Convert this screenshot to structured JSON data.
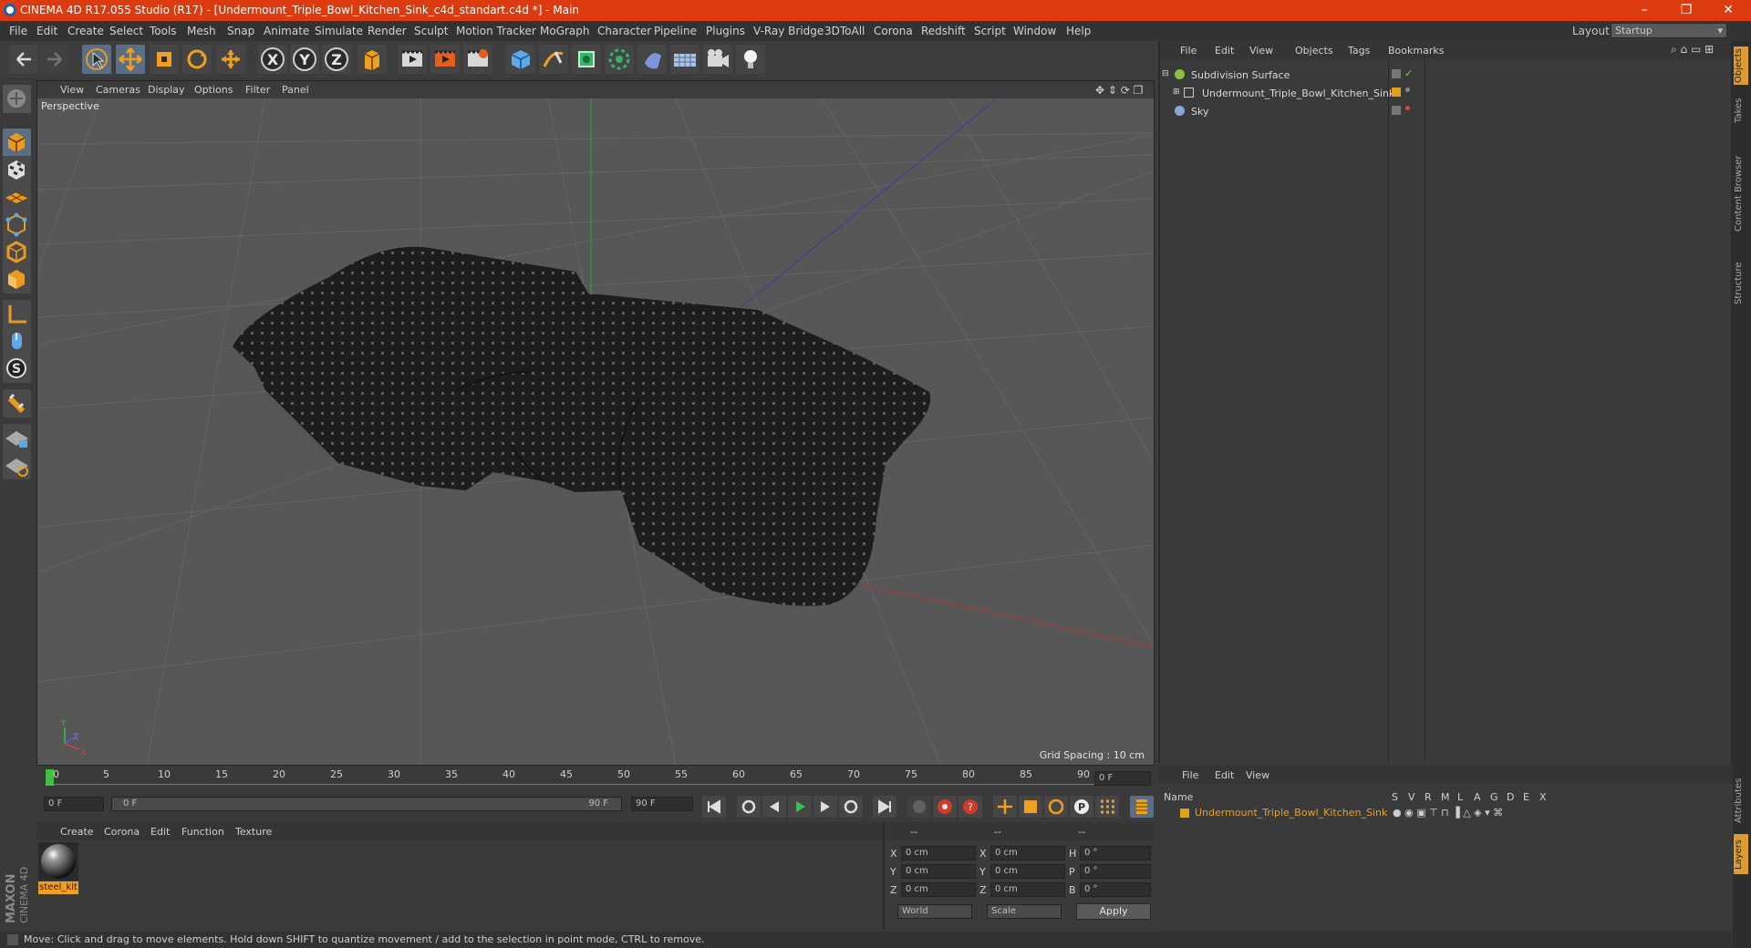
{
  "window": {
    "title": "CINEMA 4D R17.055 Studio (R17) - [Undermount_Triple_Bowl_Kitchen_Sink_c4d_standart.c4d *] - Main",
    "minimize": "–",
    "restore": "❐",
    "close": "✕"
  },
  "menubar": {
    "items": [
      "File",
      "Edit",
      "Create",
      "Select",
      "Tools",
      "Mesh",
      "Snap",
      "Animate",
      "Simulate",
      "Render",
      "Sculpt",
      "Motion Tracker",
      "MoGraph",
      "Character",
      "Pipeline",
      "Plugins",
      "V-Ray Bridge",
      "3DToAll",
      "Corona",
      "Redshift",
      "Script",
      "Window",
      "Help"
    ],
    "layout_label": "Layout:",
    "layout_value": "Startup"
  },
  "toolbar": {
    "axis_x": "X",
    "axis_y": "Y",
    "axis_z": "Z",
    "icons": [
      "undo-icon",
      "redo-icon",
      "select-arrow-icon",
      "move-icon",
      "scale-icon",
      "rotate-icon",
      "move-last-icon",
      "axis-x-icon",
      "axis-y-icon",
      "axis-z-icon",
      "coordinate-system-icon",
      "render-view-icon",
      "render-picture-viewer-icon",
      "render-settings-icon",
      "cube-icon",
      "pen-icon",
      "subdivision-icon",
      "array-icon",
      "deformer-icon",
      "floor-icon",
      "camera-icon",
      "light-icon"
    ]
  },
  "viewport": {
    "menu": [
      "View",
      "Cameras",
      "Display",
      "Options",
      "Filter",
      "Panel"
    ],
    "label": "Perspective",
    "grid_spacing": "Grid Spacing : 10 cm",
    "axis_y": "Y",
    "axis_z": "Z",
    "axis_x": "X"
  },
  "object_manager": {
    "menu": [
      "File",
      "Edit",
      "View",
      "Objects",
      "Tags",
      "Bookmarks"
    ],
    "objects": [
      {
        "name": "Subdivision Surface",
        "color": "#8ac23f"
      },
      {
        "name": "Undermount_Triple_Bowl_Kitchen_Sink",
        "color": "#e0a01e"
      },
      {
        "name": "Sky",
        "color": "#8aa8d6"
      }
    ]
  },
  "side_tabs": [
    "Objects",
    "Takes",
    "Content Browser",
    "Structure",
    "Attributes",
    "Layers"
  ],
  "timeline": {
    "ticks": [
      "0",
      "5",
      "10",
      "15",
      "20",
      "25",
      "30",
      "35",
      "40",
      "45",
      "50",
      "55",
      "60",
      "65",
      "70",
      "75",
      "80",
      "85",
      "90"
    ],
    "current_frame": "0 F",
    "start_field": "0 F",
    "range_start": "0 F",
    "range_end": "90 F",
    "end_field": "90 F"
  },
  "material_manager": {
    "menu": [
      "Create",
      "Corona",
      "Edit",
      "Function",
      "Texture"
    ],
    "material_name": "steel_kit"
  },
  "coordinates": {
    "header": [
      "--",
      "--",
      "--"
    ],
    "rows": [
      {
        "a": "X",
        "av": "0 cm",
        "b": "X",
        "bv": "0 cm",
        "c": "H",
        "cv": "0 °"
      },
      {
        "a": "Y",
        "av": "0 cm",
        "b": "Y",
        "bv": "0 cm",
        "c": "P",
        "cv": "0 °"
      },
      {
        "a": "Z",
        "av": "0 cm",
        "b": "Z",
        "bv": "0 cm",
        "c": "B",
        "cv": "0 °"
      }
    ],
    "mode_world": "World",
    "mode_scale": "Scale",
    "apply": "Apply"
  },
  "layer_manager": {
    "menu": [
      "File",
      "Edit",
      "View"
    ],
    "columns": [
      "Name",
      "S",
      "V",
      "R",
      "M",
      "L",
      "A",
      "G",
      "D",
      "E",
      "X"
    ],
    "layer_name": "Undermount_Triple_Bowl_Kitchen_Sink"
  },
  "branding": {
    "maxon": "MAXON",
    "product": "CINEMA 4D"
  },
  "status": "Move: Click and drag to move elements. Hold down SHIFT to quantize movement / add to the selection in point mode, CTRL to remove."
}
